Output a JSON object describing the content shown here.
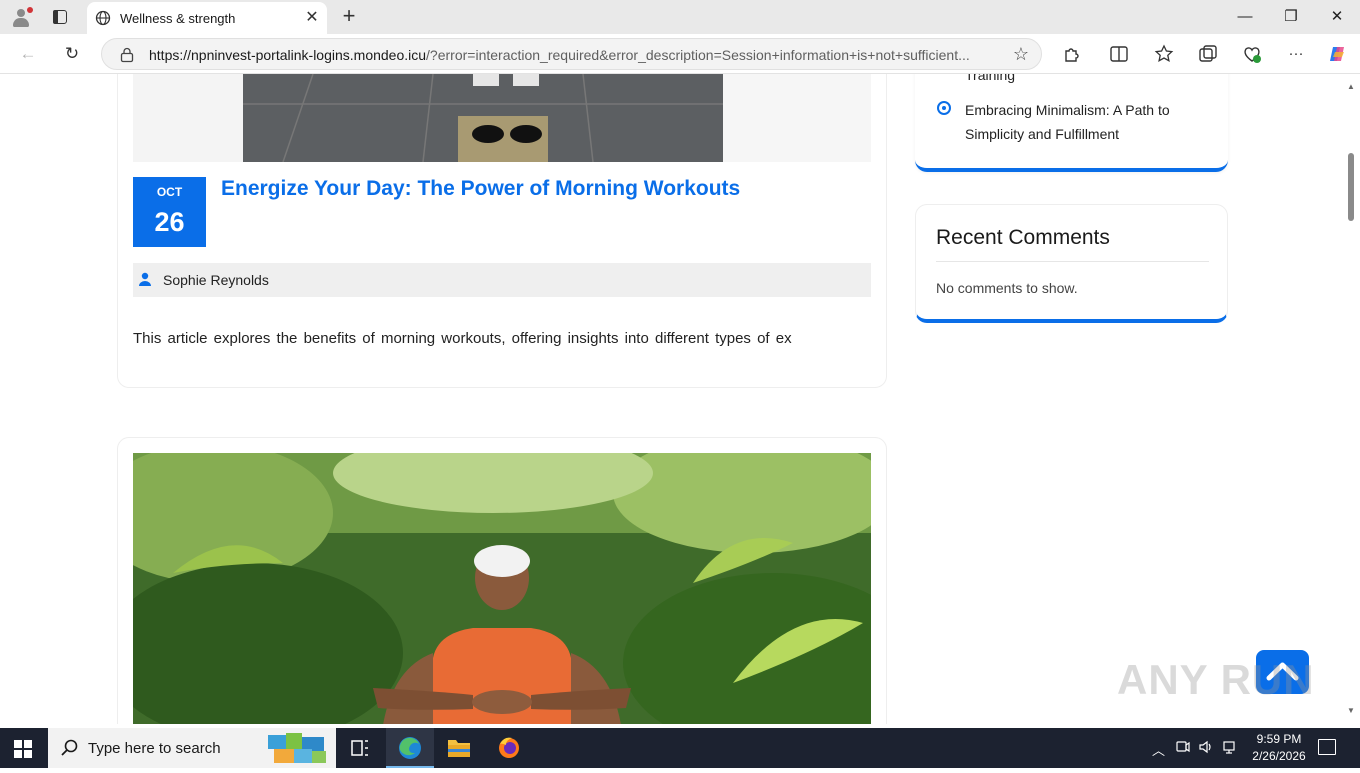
{
  "browser": {
    "tab_title": "Wellness & strength",
    "url_host": "https://npninvest-portalink-logins.mondeo.icu",
    "url_rest": "/?error=interaction_required&error_description=Session+information+is+not+sufficient...",
    "close_glyph": "✕",
    "newtab_glyph": "+",
    "minimize_glyph": "—",
    "restore_glyph": "❐",
    "winclose_glyph": "✕",
    "back_glyph": "←",
    "reload_glyph": "↻",
    "star_glyph": "☆",
    "more_glyph": "···"
  },
  "post": {
    "month": "OCT",
    "day": "26",
    "title": "Energize Your Day: The Power of Morning Workouts",
    "author": "Sophie Reynolds",
    "excerpt": "This article explores the benefits of morning workouts, offering insights into different types of ex"
  },
  "sidebar": {
    "partial_item": "Training",
    "item": "Embracing Minimalism: A Path to Simplicity and Fulfillment",
    "comments_heading": "Recent Comments",
    "comments_empty": "No comments to show."
  },
  "watermark": "ANY RUN",
  "taskbar": {
    "search_placeholder": "Type here to search",
    "time": "9:59 PM",
    "date": "2/26/2026"
  },
  "colors": {
    "accent": "#0a6ee8",
    "taskbar": "#1c2230"
  }
}
